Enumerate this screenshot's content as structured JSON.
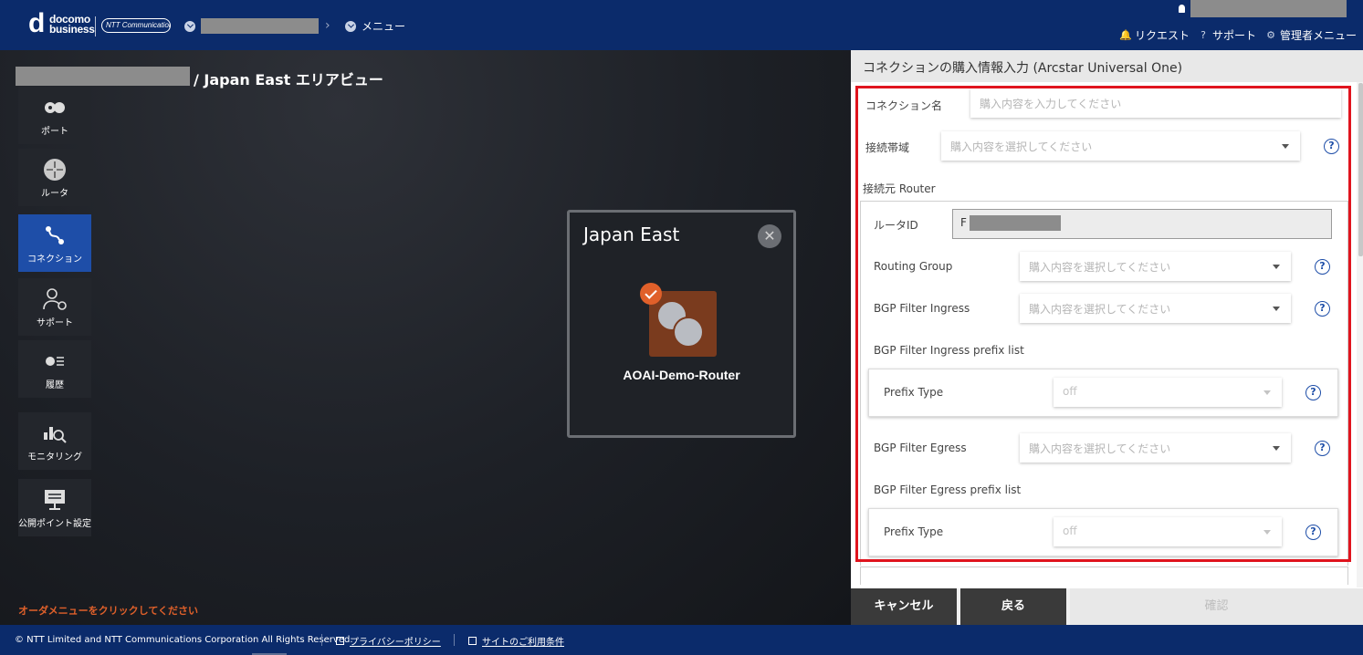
{
  "header": {
    "logo_line1": "docomo",
    "logo_line2": "business",
    "logo_ntt": "NTT Communications",
    "breadcrumb_menu": "メニュー",
    "menu_request": "リクエスト",
    "menu_support": "サポート",
    "menu_admin": "管理者メニュー"
  },
  "main": {
    "title": "/ Japan East エリアビュー",
    "order_hint": "オーダメニューをクリックしてください"
  },
  "sidenav": {
    "items": [
      {
        "label": "ポート",
        "icon": "port-icon"
      },
      {
        "label": "ルータ",
        "icon": "router-icon"
      },
      {
        "label": "コネクション",
        "icon": "connection-icon"
      },
      {
        "label": "サポート",
        "icon": "support-icon"
      },
      {
        "label": "履歴",
        "icon": "history-icon"
      },
      {
        "label": "モニタリング",
        "icon": "monitoring-icon"
      },
      {
        "label": "公開ポイント設定",
        "icon": "public-point-icon"
      }
    ]
  },
  "area": {
    "title": "Japan East",
    "router_name": "AOAI-Demo-Router"
  },
  "panel": {
    "title": "コネクションの購入情報入力 (Arcstar Universal One)",
    "connection_name_label": "コネクション名",
    "connection_name_placeholder": "購入内容を入力してください",
    "bandwidth_label": "接続帯域",
    "bandwidth_placeholder": "購入内容を選択してください",
    "source_router_label": "接続元 Router",
    "router_id_label": "ルータID",
    "router_id_value_prefix": "F",
    "routing_group_label": "Routing Group",
    "routing_group_placeholder": "購入内容を選択してください",
    "bgp_ingress_label": "BGP Filter Ingress",
    "bgp_ingress_placeholder": "購入内容を選択してください",
    "bgp_ingress_prefix_label": "BGP Filter Ingress prefix list",
    "prefix_type_label": "Prefix Type",
    "prefix_type_ingress_value": "off",
    "bgp_egress_label": "BGP Filter Egress",
    "bgp_egress_placeholder": "購入内容を選択してください",
    "bgp_egress_prefix_label": "BGP Filter Egress prefix list",
    "prefix_type_egress_value": "off",
    "help_glyph": "?"
  },
  "footer_buttons": {
    "cancel": "キャンセル",
    "back": "戻る",
    "confirm": "確認"
  },
  "footer": {
    "copyright": "© NTT Limited and NTT Communications Corporation All Rights Reserved.",
    "privacy": "プライバシーポリシー",
    "terms": "サイトのご利用条件"
  },
  "colors": {
    "header_bg": "#0b2b6b",
    "accent_blue": "#1e4ea8",
    "accent_orange": "#e0602a",
    "highlight_red": "#e0141e"
  }
}
